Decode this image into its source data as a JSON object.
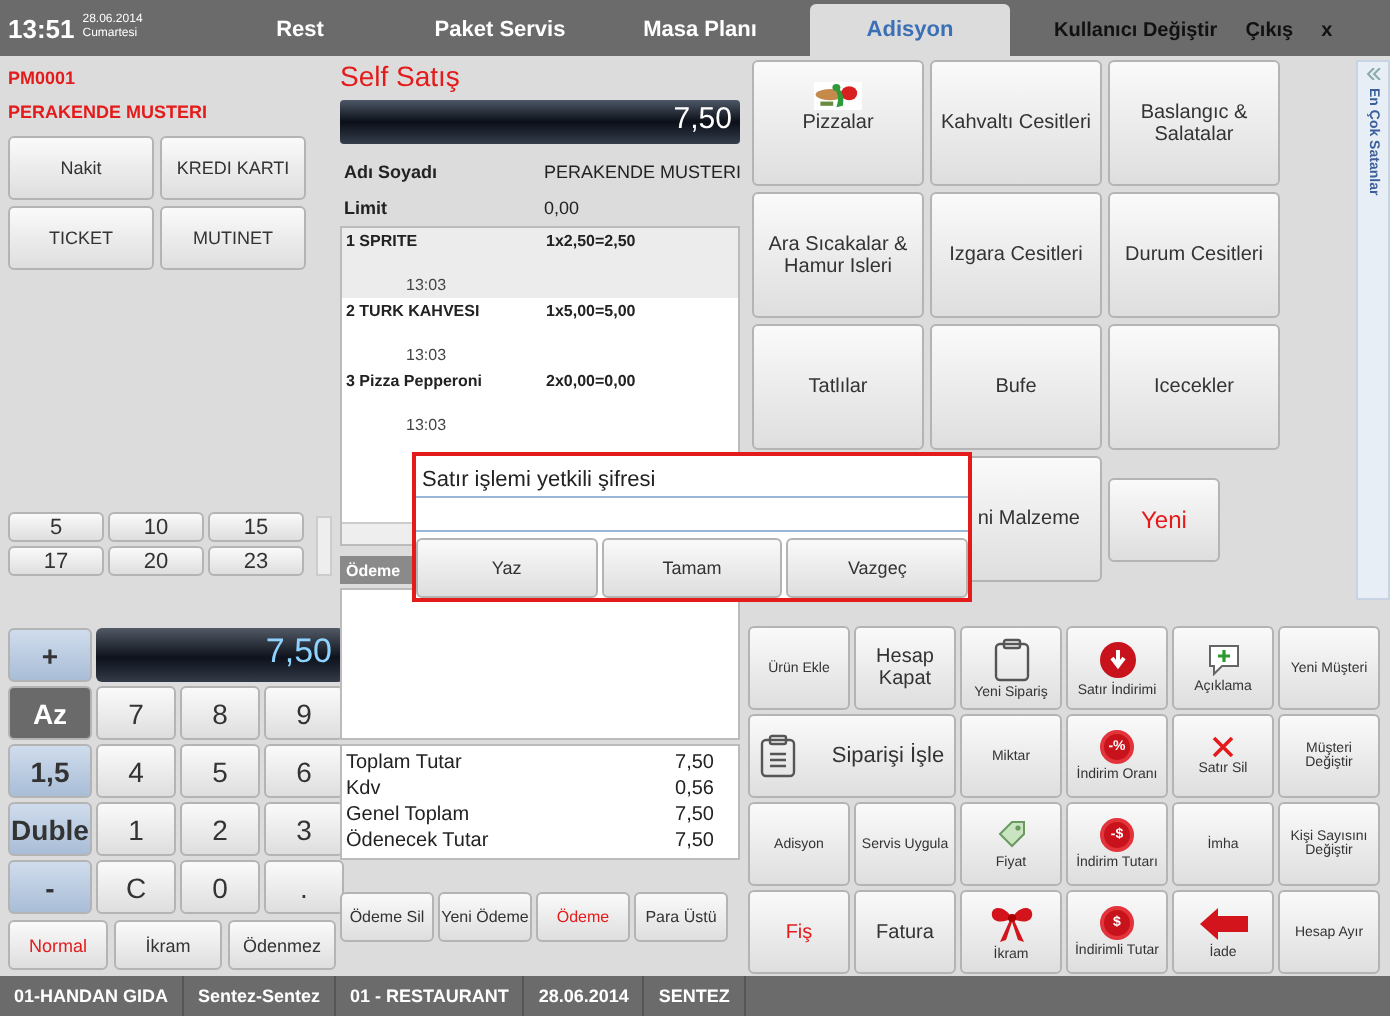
{
  "header": {
    "time": "13:51",
    "date": "28.06.2014",
    "day": "Cumartesi",
    "tabs": [
      {
        "label": "Rest",
        "selected": false
      },
      {
        "label": "Paket Servis",
        "selected": false
      },
      {
        "label": "Masa Planı",
        "selected": false
      },
      {
        "label": "Adisyon",
        "selected": true
      }
    ],
    "user_switch": "Kullanıcı Değiştir",
    "exit": "Çıkış",
    "close": "x"
  },
  "customer": {
    "code": "PM0001",
    "name": "PERAKENDE MUSTERI"
  },
  "payment_types": [
    "Nakit",
    "KREDI KARTI",
    "TICKET",
    "MUTINET"
  ],
  "quick_numbers": [
    "5",
    "10",
    "15",
    "17",
    "20",
    "23"
  ],
  "keypad": {
    "display": "7,50",
    "keys": [
      {
        "label": "+",
        "kind": "side",
        "selected": false
      },
      {
        "label": "Az",
        "kind": "side",
        "selected": true
      },
      {
        "label": "7",
        "kind": "digit"
      },
      {
        "label": "8",
        "kind": "digit"
      },
      {
        "label": "9",
        "kind": "digit"
      },
      {
        "label": "1,5",
        "kind": "side",
        "selected": false
      },
      {
        "label": "4",
        "kind": "digit"
      },
      {
        "label": "5",
        "kind": "digit"
      },
      {
        "label": "6",
        "kind": "digit"
      },
      {
        "label": "Duble",
        "kind": "side",
        "selected": false
      },
      {
        "label": "1",
        "kind": "digit"
      },
      {
        "label": "2",
        "kind": "digit"
      },
      {
        "label": "3",
        "kind": "digit"
      },
      {
        "label": "-",
        "kind": "side",
        "selected": false
      },
      {
        "label": "C",
        "kind": "digit"
      },
      {
        "label": "0",
        "kind": "digit"
      },
      {
        "label": ".",
        "kind": "digit"
      }
    ]
  },
  "modes": [
    {
      "label": "Normal",
      "selected": true
    },
    {
      "label": "İkram",
      "selected": false
    },
    {
      "label": "Ödenmez",
      "selected": false
    }
  ],
  "sale": {
    "title": "Self Satış",
    "total": "7,50",
    "info": [
      {
        "label": "Adı Soyadı",
        "value": "PERAKENDE MUSTERI"
      },
      {
        "label": "Limit",
        "value": "0,00"
      }
    ],
    "items": [
      {
        "name": "1 SPRITE",
        "amount": "1x2,50=2,50",
        "time": "13:03",
        "selected": true
      },
      {
        "name": "2 TURK KAHVESI",
        "amount": "1x5,00=5,00",
        "time": "13:03",
        "selected": false
      },
      {
        "name": "3 Pizza Pepperoni",
        "amount": "2x0,00=0,00",
        "time": "13:03",
        "selected": false
      }
    ],
    "payments_header": "Ödeme",
    "totals": [
      {
        "label": "Toplam Tutar",
        "value": "7,50"
      },
      {
        "label": "Kdv",
        "value": "0,56"
      },
      {
        "label": "Genel Toplam",
        "value": "7,50"
      },
      {
        "label": "Ödenecek Tutar",
        "value": "7,50"
      }
    ],
    "buttons": [
      {
        "label": "Ödeme Sil",
        "highlighted": false
      },
      {
        "label": "Yeni Ödeme",
        "highlighted": false
      },
      {
        "label": "Ödeme",
        "highlighted": true
      },
      {
        "label": "Para Üstü",
        "highlighted": false
      }
    ]
  },
  "categories": [
    {
      "label": "Pizzalar",
      "kind": "picture"
    },
    {
      "label": "Kahvaltı Cesitleri",
      "kind": "text"
    },
    {
      "label": "Baslangıc & Salatalar",
      "kind": "text"
    },
    {
      "label": "Ara Sıcakalar & Hamur Isleri",
      "kind": "text"
    },
    {
      "label": "Izgara Cesitleri",
      "kind": "text"
    },
    {
      "label": "Durum Cesitleri",
      "kind": "text"
    },
    {
      "label": "Tatlılar",
      "kind": "text"
    },
    {
      "label": "Bufe",
      "kind": "text"
    },
    {
      "label": "Icecekler",
      "kind": "text"
    }
  ],
  "extra_buttons": [
    {
      "label": "ni Malzeme",
      "highlighted": false
    },
    {
      "label": "Yeni",
      "highlighted": true
    }
  ],
  "side_panel": {
    "title": "En Çok Satanlar"
  },
  "actions": [
    {
      "label": "Ürün Ekle",
      "kind": "plain",
      "highlighted": false
    },
    {
      "label": "Hesap Kapat",
      "kind": "large",
      "highlighted": false
    },
    {
      "label": "Yeni Sipariş",
      "kind": "clipboard",
      "highlighted": false
    },
    {
      "label": "Satır İndirimi",
      "kind": "badge-down",
      "highlighted": false
    },
    {
      "label": "Açıklama",
      "kind": "bubble",
      "highlighted": false
    },
    {
      "label": "Yeni Müşteri",
      "kind": "plain",
      "highlighted": false
    },
    {
      "label": "Siparişi İşle",
      "kind": "wide",
      "highlighted": false
    },
    {
      "label": "Miktar",
      "kind": "plain",
      "highlighted": false
    },
    {
      "label": "İndirim Oranı",
      "kind": "badge",
      "badge": "-%",
      "highlighted": false
    },
    {
      "label": "Satır Sil",
      "kind": "cross",
      "highlighted": false
    },
    {
      "label": "Müşteri Değiştir",
      "kind": "plain",
      "highlighted": false
    },
    {
      "label": "Adisyon",
      "kind": "plain",
      "highlighted": false
    },
    {
      "label": "Servis Uygula",
      "kind": "plain",
      "highlighted": false
    },
    {
      "label": "Fiyat",
      "kind": "tag",
      "highlighted": false
    },
    {
      "label": "İndirim Tutarı",
      "kind": "badge",
      "badge": "-$",
      "highlighted": false
    },
    {
      "label": "İmha",
      "kind": "plain",
      "highlighted": false
    },
    {
      "label": "Kişi Sayısını Değiştir",
      "kind": "plain",
      "highlighted": false
    },
    {
      "label": "Fiş",
      "kind": "large",
      "highlighted": true
    },
    {
      "label": "Fatura",
      "kind": "large",
      "highlighted": false
    },
    {
      "label": "İkram",
      "kind": "bow",
      "highlighted": false
    },
    {
      "label": "İndirimli Tutar",
      "kind": "badge",
      "badge": "$",
      "highlighted": false
    },
    {
      "label": "İade",
      "kind": "arrow",
      "highlighted": false
    },
    {
      "label": "Hesap Ayır",
      "kind": "plain",
      "highlighted": false
    }
  ],
  "dialog": {
    "title": "Satır işlemi yetkili şifresi",
    "buttons": [
      "Yaz",
      "Tamam",
      "Vazgeç"
    ]
  },
  "status_bar": [
    "01-HANDAN GIDA",
    "Sentez-Sentez",
    "01 - RESTAURANT",
    "28.06.2014",
    "SENTEZ"
  ]
}
